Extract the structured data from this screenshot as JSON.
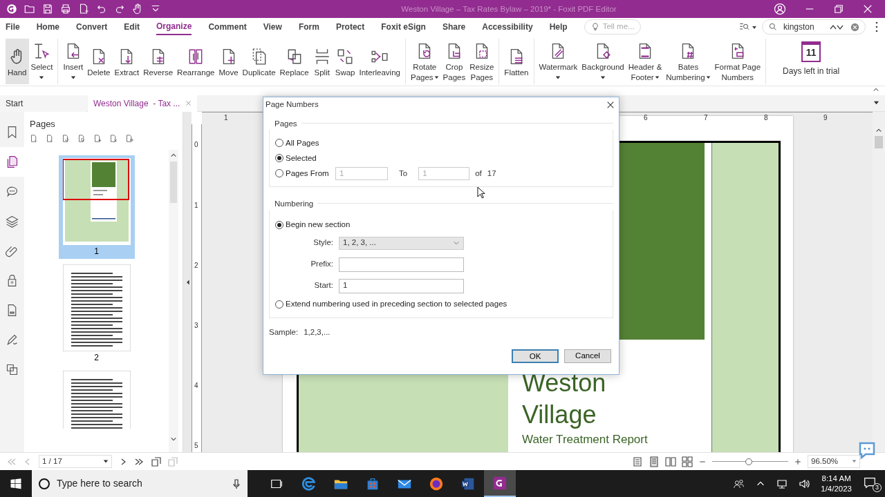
{
  "window": {
    "title": "Weston Village – Tax Rates Bylaw – 2019* - Foxit PDF Editor"
  },
  "menu_tabs": [
    {
      "label": "File",
      "selected": false
    },
    {
      "label": "Home",
      "selected": false
    },
    {
      "label": "Convert",
      "selected": false
    },
    {
      "label": "Edit",
      "selected": false
    },
    {
      "label": "Organize",
      "selected": true
    },
    {
      "label": "Comment",
      "selected": false
    },
    {
      "label": "View",
      "selected": false
    },
    {
      "label": "Form",
      "selected": false
    },
    {
      "label": "Protect",
      "selected": false
    },
    {
      "label": "Foxit eSign",
      "selected": false
    },
    {
      "label": "Share",
      "selected": false
    },
    {
      "label": "Accessibility",
      "selected": false
    },
    {
      "label": "Help",
      "selected": false
    }
  ],
  "tell_me": {
    "placeholder": "Tell me..."
  },
  "search": {
    "value": "kingston"
  },
  "ribbon_groups": [
    {
      "tools": [
        {
          "label": "Hand",
          "selected": true
        },
        {
          "label": "Select",
          "selected": false,
          "dropdown": true
        }
      ]
    },
    {
      "tools": [
        {
          "label": "Insert",
          "selected": false,
          "dropdown": true
        },
        {
          "label": "Delete",
          "selected": false
        },
        {
          "label": "Extract",
          "selected": false
        },
        {
          "label": "Reverse",
          "selected": false
        },
        {
          "label": "Rearrange",
          "selected": false
        },
        {
          "label": "Move",
          "selected": false
        },
        {
          "label": "Duplicate",
          "selected": false
        },
        {
          "label": "Replace",
          "selected": false
        },
        {
          "label": "Split",
          "selected": false
        },
        {
          "label": "Swap",
          "selected": false
        },
        {
          "label": "Interleaving",
          "selected": false
        }
      ]
    },
    {
      "tools": [
        {
          "label": "Rotate\nPages",
          "selected": false,
          "dropdown": true
        },
        {
          "label": "Crop\nPages",
          "selected": false
        },
        {
          "label": "Resize\nPages",
          "selected": false
        }
      ]
    },
    {
      "tools": [
        {
          "label": "Flatten",
          "selected": false
        }
      ]
    },
    {
      "tools": [
        {
          "label": "Watermark",
          "selected": false,
          "dropdown": true
        },
        {
          "label": "Background",
          "selected": false,
          "dropdown": true
        },
        {
          "label": "Header &\nFooter",
          "selected": false,
          "dropdown": true
        },
        {
          "label": "Bates\nNumbering",
          "selected": false,
          "dropdown": true
        },
        {
          "label": "Format Page\nNumbers",
          "selected": false
        }
      ]
    }
  ],
  "trial": {
    "days": "11",
    "label": "Days left in trial"
  },
  "doc_tabs": [
    {
      "label": "Start",
      "selected": false,
      "closable": false
    },
    {
      "label": "Weston Village  - Tax ...",
      "selected": true,
      "closable": true
    }
  ],
  "nav_panels": [
    {
      "kind": "bookmark",
      "selected": false
    },
    {
      "kind": "pages",
      "selected": true
    },
    {
      "kind": "comment",
      "selected": false
    },
    {
      "kind": "layers",
      "selected": false
    },
    {
      "kind": "attachment",
      "selected": false
    },
    {
      "kind": "security",
      "selected": false
    },
    {
      "kind": "document",
      "selected": false
    },
    {
      "kind": "signature",
      "selected": false
    },
    {
      "kind": "compare",
      "selected": false
    }
  ],
  "pages_panel": {
    "title": "Pages",
    "thumbnails": [
      {
        "kind": "cover",
        "label": "1",
        "selected": true
      },
      {
        "kind": "text",
        "label": "2",
        "selected": false
      },
      {
        "kind": "text",
        "selected": false
      }
    ]
  },
  "ruler": {
    "h_labels": [
      "1",
      "6",
      "7",
      "8",
      "9"
    ],
    "v_labels": [
      "0",
      "1",
      "2",
      "3",
      "4",
      "5"
    ]
  },
  "document": {
    "heading_lines": [
      "Weston",
      "Village"
    ],
    "subtitle": "Water Treatment Report"
  },
  "dialog": {
    "title": "Page Numbers",
    "pages_group": {
      "legend": "Pages",
      "options": [
        {
          "label": "All Pages",
          "selected": false
        },
        {
          "label": "Selected",
          "selected": true
        },
        {
          "label": "Pages From",
          "selected": false
        }
      ],
      "from_value": "1",
      "to_label": "To",
      "to_value": "1",
      "of_label": "of",
      "total": "17"
    },
    "numbering_group": {
      "legend": "Numbering",
      "options": [
        {
          "label": "Begin new section",
          "selected": true
        },
        {
          "label": "Extend numbering used in preceding section to selected pages",
          "selected": false
        }
      ],
      "style_label": "Style:",
      "style_value": "1, 2, 3, ...",
      "prefix_label": "Prefix:",
      "start_label": "Start:",
      "start_value": "1"
    },
    "sample_label": "Sample:",
    "sample_value": "1,2,3,...",
    "buttons": [
      {
        "label": "OK",
        "default": true
      },
      {
        "label": "Cancel",
        "default": false
      }
    ]
  },
  "status_bar": {
    "page": "1 / 17",
    "zoom_slider": {
      "level": 0.48
    },
    "zoom": "96.50%"
  },
  "taskbar": {
    "search_placeholder": "Type here to search",
    "apps": [
      {
        "kind": "taskview",
        "active": false
      },
      {
        "kind": "edge",
        "active": false
      },
      {
        "kind": "explorer",
        "active": false
      },
      {
        "kind": "store",
        "active": false
      },
      {
        "kind": "mail",
        "active": false
      },
      {
        "kind": "firefox",
        "active": false
      },
      {
        "kind": "word",
        "active": false
      },
      {
        "kind": "foxit",
        "active": true
      }
    ],
    "time": "8:14 AM",
    "date": "1/4/2023",
    "notifications": "3"
  }
}
